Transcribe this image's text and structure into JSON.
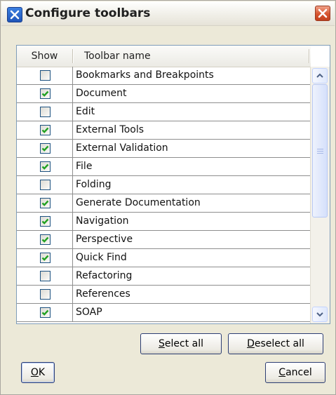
{
  "window": {
    "title": "Configure toolbars"
  },
  "list": {
    "columns": {
      "show": "Show",
      "name": "Toolbar name"
    },
    "rows": [
      {
        "name": "Bookmarks and Breakpoints",
        "checked": false
      },
      {
        "name": "Document",
        "checked": true
      },
      {
        "name": "Edit",
        "checked": false
      },
      {
        "name": "External Tools",
        "checked": true
      },
      {
        "name": "External Validation",
        "checked": true
      },
      {
        "name": "File",
        "checked": true
      },
      {
        "name": "Folding",
        "checked": false
      },
      {
        "name": "Generate Documentation",
        "checked": true
      },
      {
        "name": "Navigation",
        "checked": true
      },
      {
        "name": "Perspective",
        "checked": true
      },
      {
        "name": "Quick Find",
        "checked": true
      },
      {
        "name": "Refactoring",
        "checked": false
      },
      {
        "name": "References",
        "checked": false
      },
      {
        "name": "SOAP",
        "checked": true
      }
    ]
  },
  "buttons": {
    "select_all": {
      "accel": "S",
      "rest": "elect all"
    },
    "deselect_all": {
      "accel": "D",
      "rest": "eselect all"
    },
    "ok": {
      "accel": "O",
      "rest": "K"
    },
    "cancel": {
      "accel": "C",
      "rest": "ancel"
    }
  },
  "colors": {
    "checkmark": "#21a121",
    "close_button": "#d6532e"
  }
}
